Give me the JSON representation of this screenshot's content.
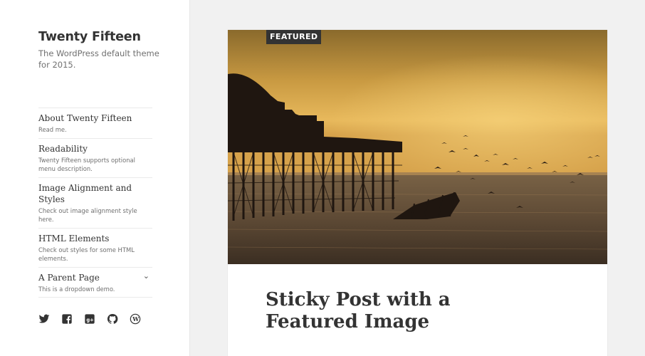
{
  "site": {
    "title": "Twenty Fifteen",
    "description": "The WordPress default theme for 2015."
  },
  "menu": [
    {
      "label": "About Twenty Fifteen",
      "description": "Read me."
    },
    {
      "label": "Readability",
      "description": "Twenty Fifteen supports optional menu description."
    },
    {
      "label": "Image Alignment and Styles",
      "description": "Check out image alignment style here."
    },
    {
      "label": "HTML Elements",
      "description": "Check out styles for some HTML elements."
    },
    {
      "label": "A Parent Page",
      "description": "This is a dropdown demo.",
      "has_dropdown": true
    }
  ],
  "social_icons": [
    "twitter-icon",
    "facebook-icon",
    "google-plus-icon",
    "github-icon",
    "wordpress-icon"
  ],
  "post": {
    "badge": "FEATURED",
    "title": "Sticky Post with a Featured Image",
    "image_subject": "sunset-pier-with-birds"
  },
  "colors": {
    "background": "#f1f1f1",
    "sidebar": "#ffffff",
    "text": "#333333",
    "muted": "#707070",
    "badge": "#333333"
  }
}
